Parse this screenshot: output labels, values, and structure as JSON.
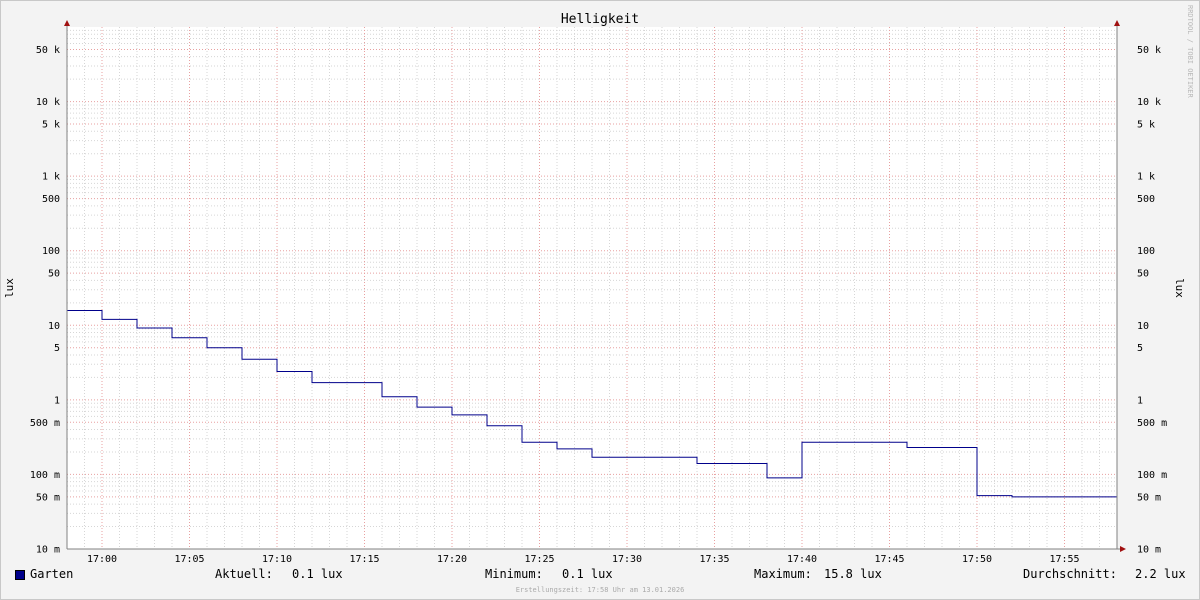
{
  "colors": {
    "series": "#00008b",
    "grid_minor": "#d6d6d6",
    "grid_major": "#e8a0a0",
    "axis": "#808080",
    "arrow": "#a01010",
    "background": "#f3f3f3",
    "plot_background": "#ffffff"
  },
  "watermark": "RRDTOOL / TOBI OETIKER",
  "footer": "Erstellungszeit: 17:58 Uhr am 13.01.2026",
  "legend": {
    "series_name": "Garten",
    "current_label": "Aktuell:",
    "current_value": "0.1 lux",
    "min_label": "Minimum:",
    "min_value": "0.1 lux",
    "max_label": "Maximum:",
    "max_value": "15.8 lux",
    "avg_label": "Durchschnitt:",
    "avg_value": "2.2 lux"
  },
  "chart_data": {
    "type": "line",
    "title": "Helligkeit",
    "ylabel": "lux",
    "ylabel_right": "lux",
    "y_scale": "log",
    "ylim": [
      10,
      100000
    ],
    "y_unit_note": "tick labels use SI prefixes (m = milli, k = kilo)",
    "y_ticks": [
      {
        "value": 0.01,
        "label": "10 m"
      },
      {
        "value": 0.05,
        "label": "50 m"
      },
      {
        "value": 0.1,
        "label": "100 m"
      },
      {
        "value": 0.5,
        "label": "500 m"
      },
      {
        "value": 1,
        "label": "1"
      },
      {
        "value": 5,
        "label": "5"
      },
      {
        "value": 10,
        "label": "10"
      },
      {
        "value": 50,
        "label": "50"
      },
      {
        "value": 100,
        "label": "100"
      },
      {
        "value": 500,
        "label": "500"
      },
      {
        "value": 1000,
        "label": "1 k"
      },
      {
        "value": 5000,
        "label": "5 k"
      },
      {
        "value": 10000,
        "label": "10 k"
      },
      {
        "value": 50000,
        "label": "50 k"
      }
    ],
    "x_ticks": [
      "17:00",
      "17:05",
      "17:10",
      "17:15",
      "17:20",
      "17:25",
      "17:30",
      "17:35",
      "17:40",
      "17:45",
      "17:50",
      "17:55"
    ],
    "x_range": [
      "16:58",
      "17:58"
    ],
    "grid": true,
    "legend_position": "bottom",
    "series": [
      {
        "name": "Garten",
        "step": true,
        "points": [
          {
            "t": "16:58",
            "v": 15.8
          },
          {
            "t": "17:00",
            "v": 12.0
          },
          {
            "t": "17:02",
            "v": 9.2
          },
          {
            "t": "17:04",
            "v": 6.8
          },
          {
            "t": "17:06",
            "v": 5.0
          },
          {
            "t": "17:08",
            "v": 3.5
          },
          {
            "t": "17:10",
            "v": 2.4
          },
          {
            "t": "17:12",
            "v": 1.7
          },
          {
            "t": "17:16",
            "v": 1.1
          },
          {
            "t": "17:18",
            "v": 0.8
          },
          {
            "t": "17:20",
            "v": 0.63
          },
          {
            "t": "17:22",
            "v": 0.45
          },
          {
            "t": "17:24",
            "v": 0.27
          },
          {
            "t": "17:26",
            "v": 0.22
          },
          {
            "t": "17:28",
            "v": 0.17
          },
          {
            "t": "17:34",
            "v": 0.14
          },
          {
            "t": "17:38",
            "v": 0.09
          },
          {
            "t": "17:40",
            "v": 0.27
          },
          {
            "t": "17:46",
            "v": 0.23
          },
          {
            "t": "17:50",
            "v": 0.052
          },
          {
            "t": "17:52",
            "v": 0.05
          },
          {
            "t": "17:58",
            "v": 0.05
          }
        ]
      }
    ]
  }
}
